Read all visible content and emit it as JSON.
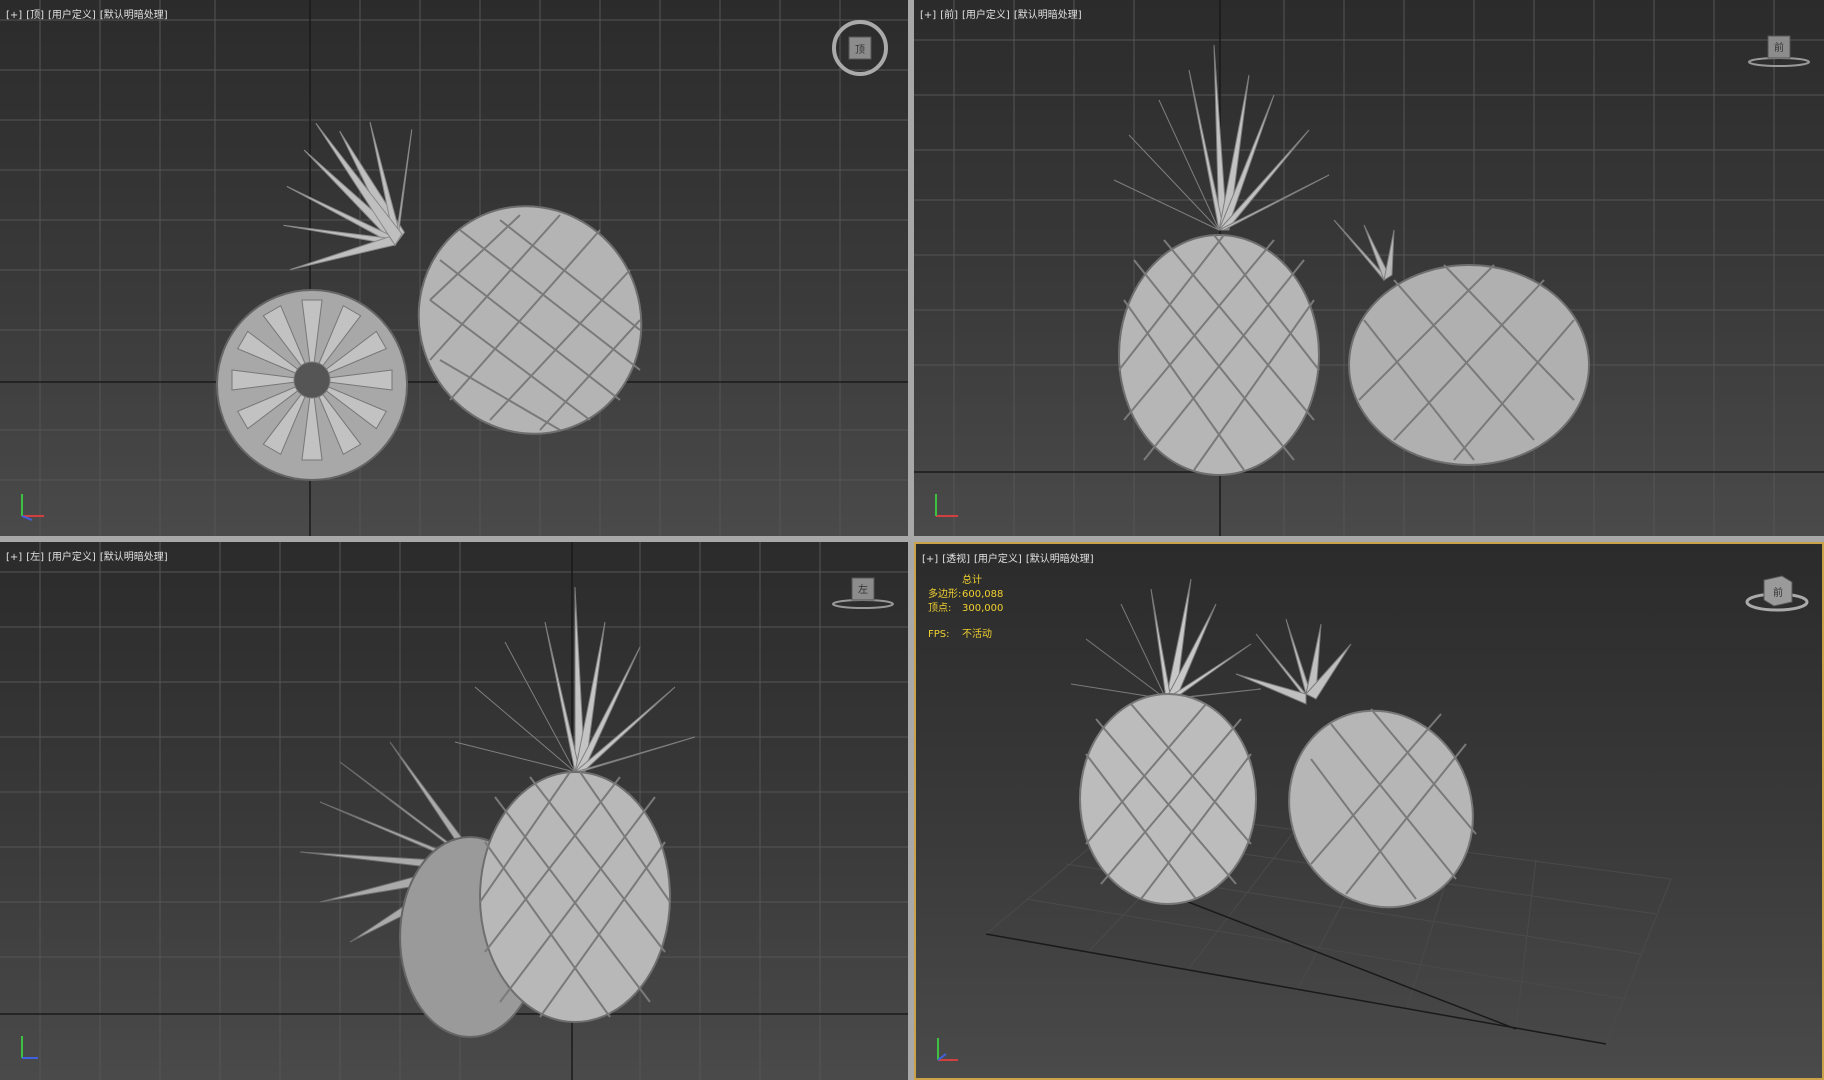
{
  "viewports": [
    {
      "id": "top",
      "labels": [
        "[+]",
        "[顶]",
        "[用户定义]",
        "[默认明暗处理]"
      ],
      "viewcube_label": "顶",
      "active": false
    },
    {
      "id": "front",
      "labels": [
        "[+]",
        "[前]",
        "[用户定义]",
        "[默认明暗处理]"
      ],
      "viewcube_label": "前",
      "active": false
    },
    {
      "id": "left",
      "labels": [
        "[+]",
        "[左]",
        "[用户定义]",
        "[默认明暗处理]"
      ],
      "viewcube_label": "左",
      "active": false
    },
    {
      "id": "perspective",
      "labels": [
        "[+]",
        "[透视]",
        "[用户定义]",
        "[默认明暗处理]"
      ],
      "viewcube_label": "前",
      "active": true,
      "stats": {
        "header": "总计",
        "polygons_label": "多边形:",
        "polygons_value": "600,088",
        "vertices_label": "顶点:",
        "vertices_value": "300,000",
        "fps_label": "FPS:",
        "fps_value": "不活动"
      }
    }
  ],
  "colors": {
    "active_border": "#c9a24a",
    "stats_text": "#f0d030",
    "grid_line": "#5a5a5a",
    "model": "#bdbdbd"
  }
}
